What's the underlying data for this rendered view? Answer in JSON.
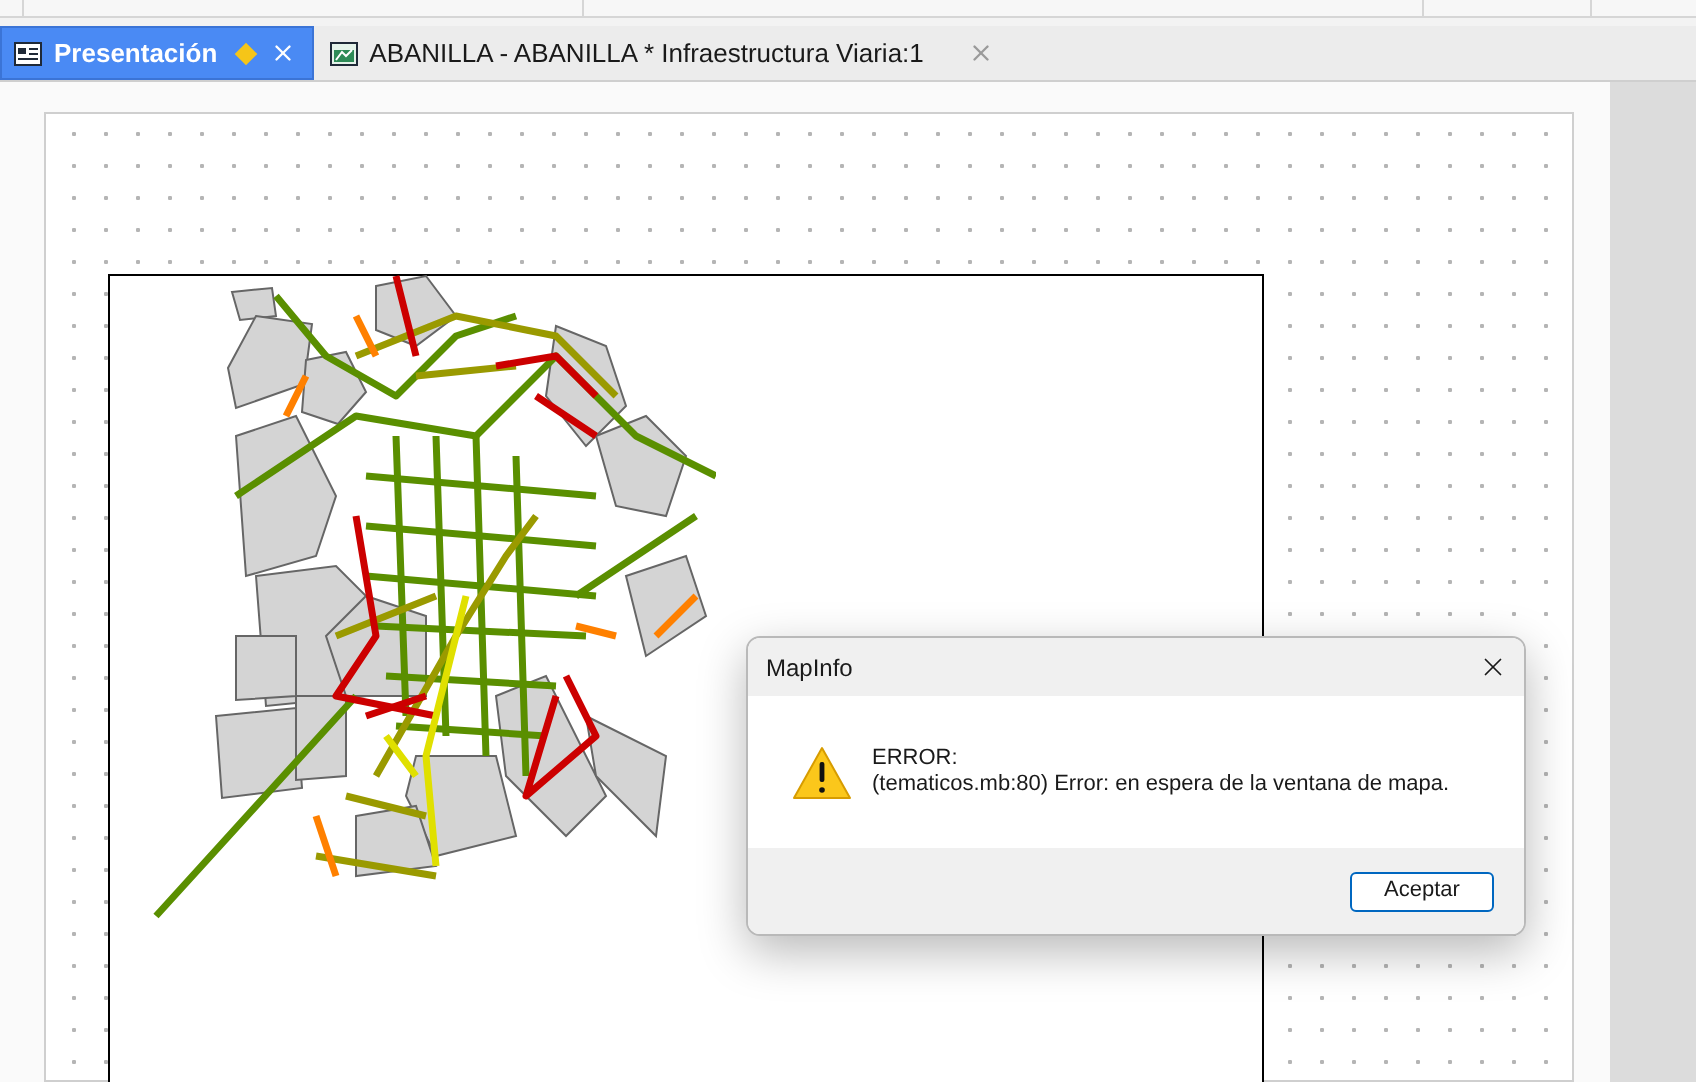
{
  "tabs": [
    {
      "label": "Presentación",
      "kind": "layout",
      "selected": true,
      "modified": true
    },
    {
      "label": "ABANILLA - ABANILLA * Infraestructura Viaria:1",
      "kind": "map",
      "selected": false,
      "modified": false
    }
  ],
  "dialog": {
    "title": "MapInfo",
    "heading": "ERROR:",
    "message": "(tematicos.mb:80) Error: en espera de la ventana de mapa.",
    "button": "Aceptar"
  }
}
